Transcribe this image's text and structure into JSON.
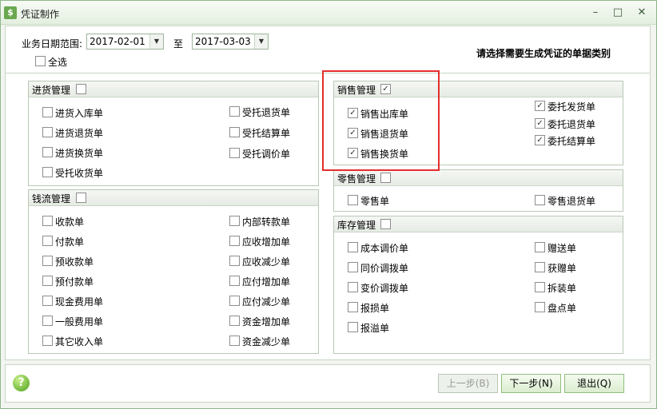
{
  "window": {
    "title": "凭证制作",
    "icon": "app-bag-icon",
    "controls": {
      "minimize": "–",
      "maximize": "□",
      "close": "✕"
    }
  },
  "filter": {
    "date_range_label": "业务日期范围:",
    "start_date": "2017-02-01",
    "to_label": "至",
    "end_date": "2017-03-03",
    "select_all_label": "全选",
    "select_all_checked": false,
    "hint": "请选择需要生成凭证的单据类别"
  },
  "groups": {
    "purchase": {
      "title": "进货管理",
      "checked": false,
      "items": [
        {
          "label": "进货入库单",
          "checked": false
        },
        {
          "label": "进货退货单",
          "checked": false
        },
        {
          "label": "进货换货单",
          "checked": false
        },
        {
          "label": "受托收货单",
          "checked": false
        },
        {
          "label": "受托退货单",
          "checked": false
        },
        {
          "label": "受托结算单",
          "checked": false
        },
        {
          "label": "受托调价单",
          "checked": false
        }
      ]
    },
    "cash": {
      "title": "钱流管理",
      "checked": false,
      "items": [
        {
          "label": "收款单",
          "checked": false
        },
        {
          "label": "付款单",
          "checked": false
        },
        {
          "label": "预收款单",
          "checked": false
        },
        {
          "label": "预付款单",
          "checked": false
        },
        {
          "label": "现金费用单",
          "checked": false
        },
        {
          "label": "一般费用单",
          "checked": false
        },
        {
          "label": "其它收入单",
          "checked": false
        },
        {
          "label": "内部转款单",
          "checked": false
        },
        {
          "label": "应收增加单",
          "checked": false
        },
        {
          "label": "应收减少单",
          "checked": false
        },
        {
          "label": "应付增加单",
          "checked": false
        },
        {
          "label": "应付减少单",
          "checked": false
        },
        {
          "label": "资金增加单",
          "checked": false
        },
        {
          "label": "资金减少单",
          "checked": false
        }
      ]
    },
    "sales": {
      "title": "销售管理",
      "checked": true,
      "items": [
        {
          "label": "销售出库单",
          "checked": true
        },
        {
          "label": "销售退货单",
          "checked": true
        },
        {
          "label": "销售换货单",
          "checked": true
        },
        {
          "label": "委托发货单",
          "checked": true
        },
        {
          "label": "委托退货单",
          "checked": true
        },
        {
          "label": "委托结算单",
          "checked": true
        }
      ]
    },
    "retail": {
      "title": "零售管理",
      "checked": false,
      "items": [
        {
          "label": "零售单",
          "checked": false
        },
        {
          "label": "零售退货单",
          "checked": false
        }
      ]
    },
    "inventory": {
      "title": "库存管理",
      "checked": false,
      "items": [
        {
          "label": "成本调价单",
          "checked": false
        },
        {
          "label": "同价调拨单",
          "checked": false
        },
        {
          "label": "变价调拨单",
          "checked": false
        },
        {
          "label": "报损单",
          "checked": false
        },
        {
          "label": "报溢单",
          "checked": false
        },
        {
          "label": "赠送单",
          "checked": false
        },
        {
          "label": "获赠单",
          "checked": false
        },
        {
          "label": "拆装单",
          "checked": false
        },
        {
          "label": "盘点单",
          "checked": false
        }
      ]
    }
  },
  "footer": {
    "help": "?",
    "prev_button": "上一步(B)",
    "prev_enabled": false,
    "next_button": "下一步(N)",
    "exit_button": "退出(Q)"
  },
  "colors": {
    "highlight_border": "#e52d2d",
    "accent_green": "#6fb83a"
  }
}
